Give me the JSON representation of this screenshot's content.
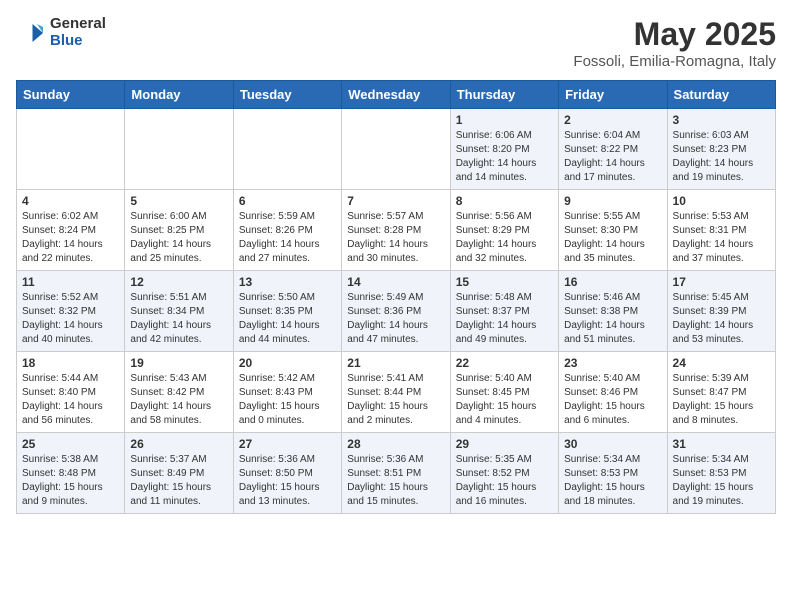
{
  "header": {
    "logo_general": "General",
    "logo_blue": "Blue",
    "month_year": "May 2025",
    "location": "Fossoli, Emilia-Romagna, Italy"
  },
  "days_of_week": [
    "Sunday",
    "Monday",
    "Tuesday",
    "Wednesday",
    "Thursday",
    "Friday",
    "Saturday"
  ],
  "weeks": [
    [
      {
        "day": "",
        "content": ""
      },
      {
        "day": "",
        "content": ""
      },
      {
        "day": "",
        "content": ""
      },
      {
        "day": "",
        "content": ""
      },
      {
        "day": "1",
        "content": "Sunrise: 6:06 AM\nSunset: 8:20 PM\nDaylight: 14 hours\nand 14 minutes."
      },
      {
        "day": "2",
        "content": "Sunrise: 6:04 AM\nSunset: 8:22 PM\nDaylight: 14 hours\nand 17 minutes."
      },
      {
        "day": "3",
        "content": "Sunrise: 6:03 AM\nSunset: 8:23 PM\nDaylight: 14 hours\nand 19 minutes."
      }
    ],
    [
      {
        "day": "4",
        "content": "Sunrise: 6:02 AM\nSunset: 8:24 PM\nDaylight: 14 hours\nand 22 minutes."
      },
      {
        "day": "5",
        "content": "Sunrise: 6:00 AM\nSunset: 8:25 PM\nDaylight: 14 hours\nand 25 minutes."
      },
      {
        "day": "6",
        "content": "Sunrise: 5:59 AM\nSunset: 8:26 PM\nDaylight: 14 hours\nand 27 minutes."
      },
      {
        "day": "7",
        "content": "Sunrise: 5:57 AM\nSunset: 8:28 PM\nDaylight: 14 hours\nand 30 minutes."
      },
      {
        "day": "8",
        "content": "Sunrise: 5:56 AM\nSunset: 8:29 PM\nDaylight: 14 hours\nand 32 minutes."
      },
      {
        "day": "9",
        "content": "Sunrise: 5:55 AM\nSunset: 8:30 PM\nDaylight: 14 hours\nand 35 minutes."
      },
      {
        "day": "10",
        "content": "Sunrise: 5:53 AM\nSunset: 8:31 PM\nDaylight: 14 hours\nand 37 minutes."
      }
    ],
    [
      {
        "day": "11",
        "content": "Sunrise: 5:52 AM\nSunset: 8:32 PM\nDaylight: 14 hours\nand 40 minutes."
      },
      {
        "day": "12",
        "content": "Sunrise: 5:51 AM\nSunset: 8:34 PM\nDaylight: 14 hours\nand 42 minutes."
      },
      {
        "day": "13",
        "content": "Sunrise: 5:50 AM\nSunset: 8:35 PM\nDaylight: 14 hours\nand 44 minutes."
      },
      {
        "day": "14",
        "content": "Sunrise: 5:49 AM\nSunset: 8:36 PM\nDaylight: 14 hours\nand 47 minutes."
      },
      {
        "day": "15",
        "content": "Sunrise: 5:48 AM\nSunset: 8:37 PM\nDaylight: 14 hours\nand 49 minutes."
      },
      {
        "day": "16",
        "content": "Sunrise: 5:46 AM\nSunset: 8:38 PM\nDaylight: 14 hours\nand 51 minutes."
      },
      {
        "day": "17",
        "content": "Sunrise: 5:45 AM\nSunset: 8:39 PM\nDaylight: 14 hours\nand 53 minutes."
      }
    ],
    [
      {
        "day": "18",
        "content": "Sunrise: 5:44 AM\nSunset: 8:40 PM\nDaylight: 14 hours\nand 56 minutes."
      },
      {
        "day": "19",
        "content": "Sunrise: 5:43 AM\nSunset: 8:42 PM\nDaylight: 14 hours\nand 58 minutes."
      },
      {
        "day": "20",
        "content": "Sunrise: 5:42 AM\nSunset: 8:43 PM\nDaylight: 15 hours\nand 0 minutes."
      },
      {
        "day": "21",
        "content": "Sunrise: 5:41 AM\nSunset: 8:44 PM\nDaylight: 15 hours\nand 2 minutes."
      },
      {
        "day": "22",
        "content": "Sunrise: 5:40 AM\nSunset: 8:45 PM\nDaylight: 15 hours\nand 4 minutes."
      },
      {
        "day": "23",
        "content": "Sunrise: 5:40 AM\nSunset: 8:46 PM\nDaylight: 15 hours\nand 6 minutes."
      },
      {
        "day": "24",
        "content": "Sunrise: 5:39 AM\nSunset: 8:47 PM\nDaylight: 15 hours\nand 8 minutes."
      }
    ],
    [
      {
        "day": "25",
        "content": "Sunrise: 5:38 AM\nSunset: 8:48 PM\nDaylight: 15 hours\nand 9 minutes."
      },
      {
        "day": "26",
        "content": "Sunrise: 5:37 AM\nSunset: 8:49 PM\nDaylight: 15 hours\nand 11 minutes."
      },
      {
        "day": "27",
        "content": "Sunrise: 5:36 AM\nSunset: 8:50 PM\nDaylight: 15 hours\nand 13 minutes."
      },
      {
        "day": "28",
        "content": "Sunrise: 5:36 AM\nSunset: 8:51 PM\nDaylight: 15 hours\nand 15 minutes."
      },
      {
        "day": "29",
        "content": "Sunrise: 5:35 AM\nSunset: 8:52 PM\nDaylight: 15 hours\nand 16 minutes."
      },
      {
        "day": "30",
        "content": "Sunrise: 5:34 AM\nSunset: 8:53 PM\nDaylight: 15 hours\nand 18 minutes."
      },
      {
        "day": "31",
        "content": "Sunrise: 5:34 AM\nSunset: 8:53 PM\nDaylight: 15 hours\nand 19 minutes."
      }
    ]
  ]
}
